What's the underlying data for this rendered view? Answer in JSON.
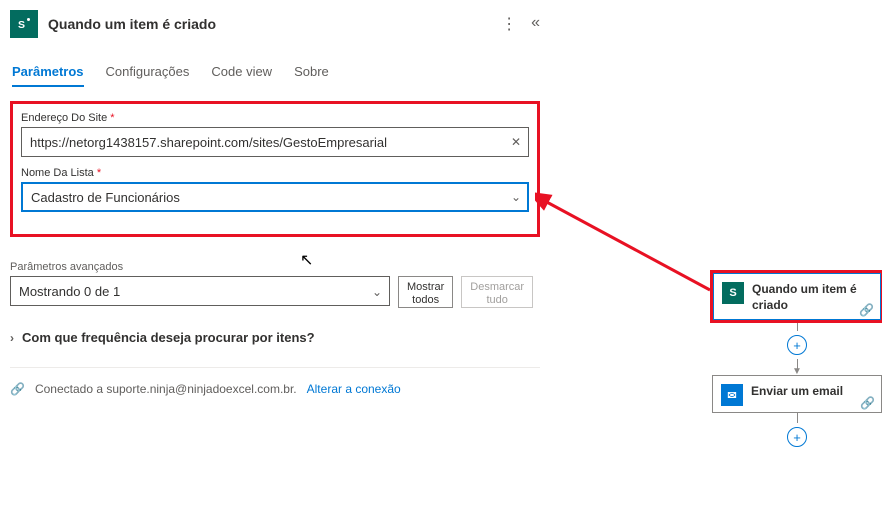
{
  "header": {
    "title": "Quando um item é criado"
  },
  "tabs": [
    {
      "label": "Parâmetros",
      "active": true
    },
    {
      "label": "Configurações",
      "active": false
    },
    {
      "label": "Code view",
      "active": false
    },
    {
      "label": "Sobre",
      "active": false
    }
  ],
  "fields": {
    "site": {
      "label": "Endereço Do Site",
      "required": "*",
      "value": "https://netorg1438157.sharepoint.com/sites/GestoEmpresarial"
    },
    "list": {
      "label": "Nome Da Lista",
      "required": "*",
      "value": "Cadastro de Funcionários"
    }
  },
  "advanced": {
    "label": "Parâmetros avançados",
    "value": "Mostrando 0 de 1",
    "show_all": "Mostrar\ntodos",
    "clear_all": "Desmarcar\ntudo"
  },
  "expander": {
    "label": "Com que frequência deseja procurar por itens?"
  },
  "connection": {
    "text": "Conectado a suporte.ninja@ninjadoexcel.com.br.",
    "change": "Alterar a conexão"
  },
  "flow": {
    "trigger": "Quando um item é criado",
    "action": "Enviar um email"
  }
}
